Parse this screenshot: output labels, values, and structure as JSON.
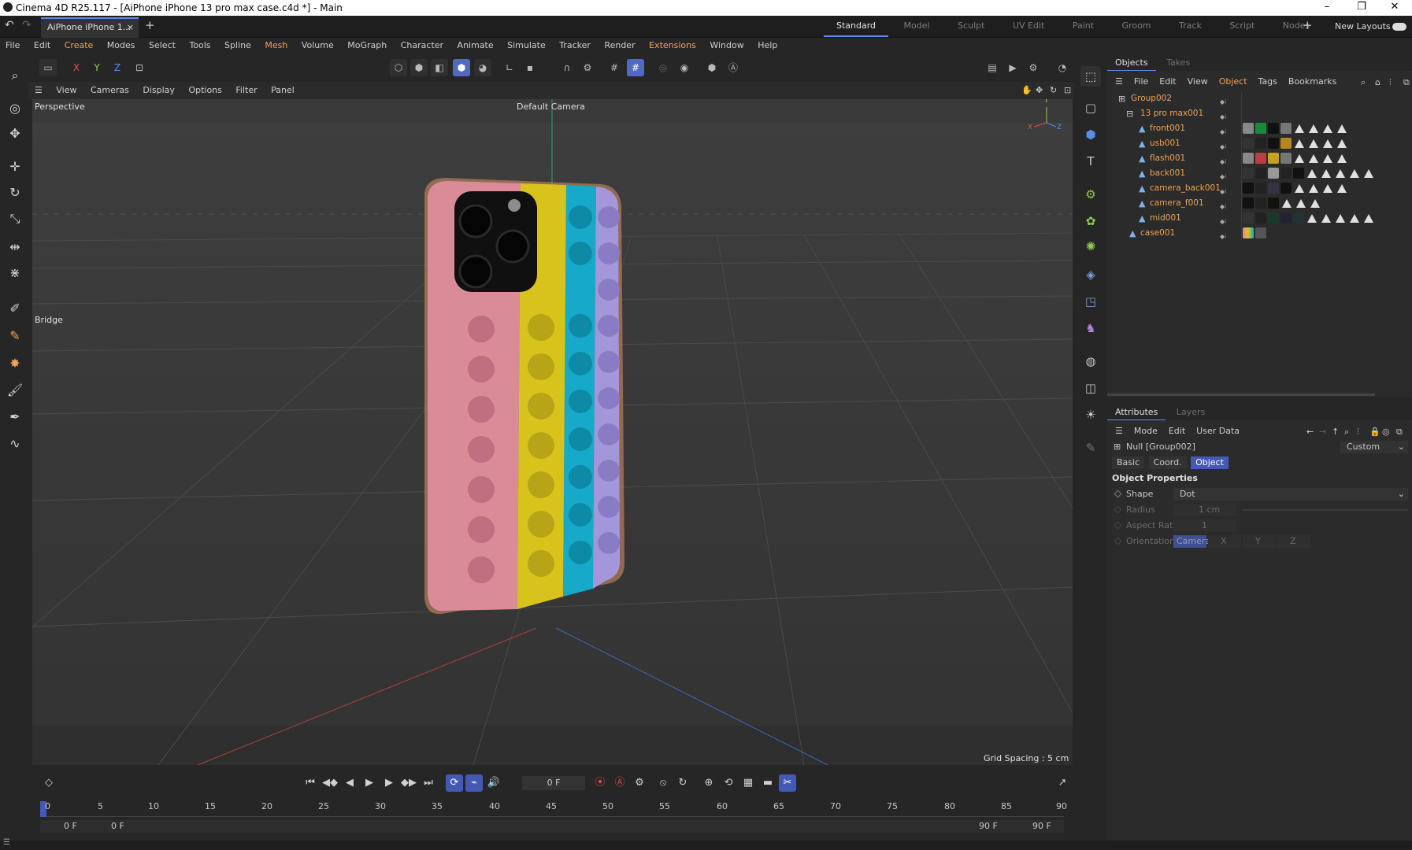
{
  "window": {
    "title": "Cinema 4D R25.117 - [AiPhone iPhone 13 pro max case.c4d *] - Main",
    "min_label": "–",
    "max_label": "❐",
    "close_label": "✕"
  },
  "tabbar": {
    "doc_tab": "AiPhone iPhone 1...",
    "doc_tab_close": "×",
    "add_tab": "+",
    "layouts": [
      {
        "label": "Standard"
      },
      {
        "label": "Model"
      },
      {
        "label": "Sculpt"
      },
      {
        "label": "UV Edit"
      },
      {
        "label": "Paint"
      },
      {
        "label": "Groom"
      },
      {
        "label": "Track"
      },
      {
        "label": "Script"
      },
      {
        "label": "Nodes"
      }
    ],
    "plus": "+",
    "new_layouts": "New Layouts"
  },
  "menubar": {
    "items": [
      "File",
      "Edit",
      "Create",
      "Modes",
      "Select",
      "Tools",
      "Spline",
      "Mesh",
      "Volume",
      "MoGraph",
      "Character",
      "Animate",
      "Simulate",
      "Tracker",
      "Render",
      "Extensions",
      "Window",
      "Help"
    ]
  },
  "toolbar": {
    "axis_x": "X",
    "axis_y": "Y",
    "axis_z": "Z"
  },
  "viewport": {
    "menu": [
      "View",
      "Cameras",
      "Display",
      "Options",
      "Filter",
      "Panel"
    ],
    "projection": "Perspective",
    "camera": "Default Camera",
    "bridge_label": "Bridge",
    "grid_spacing": "Grid Spacing : 5 cm",
    "gizmo_x": "X",
    "gizmo_y": "Y",
    "gizmo_z": "Z"
  },
  "timeline": {
    "current_frame": "0 F",
    "ruler_ticks": [
      "0",
      "5",
      "10",
      "15",
      "20",
      "25",
      "30",
      "35",
      "40",
      "45",
      "50",
      "55",
      "60",
      "65",
      "70",
      "75",
      "80",
      "85",
      "90"
    ],
    "range_start": "0 F",
    "range_start_inner": "0 F",
    "range_end_inner": "90 F",
    "range_end": "90 F"
  },
  "objects_panel": {
    "tabs": [
      {
        "label": "Objects"
      },
      {
        "label": "Takes"
      }
    ],
    "menu": [
      "File",
      "Edit",
      "View",
      "Object",
      "Tags",
      "Bookmarks"
    ],
    "rows": [
      {
        "name": "Group002",
        "indent": 0
      },
      {
        "name": "13 pro max001",
        "indent": 1
      },
      {
        "name": "front001",
        "indent": 2
      },
      {
        "name": "usb001",
        "indent": 2
      },
      {
        "name": "flash001",
        "indent": 2
      },
      {
        "name": "back001",
        "indent": 2
      },
      {
        "name": "camera_back001",
        "indent": 2
      },
      {
        "name": "camera_f001",
        "indent": 2
      },
      {
        "name": "mid001",
        "indent": 2
      },
      {
        "name": "case001",
        "indent": 1
      }
    ]
  },
  "attributes_panel": {
    "tabs": [
      {
        "label": "Attributes"
      },
      {
        "label": "Layers"
      }
    ],
    "menu": [
      "Mode",
      "Edit",
      "User Data"
    ],
    "object_name": "Null [Group002]",
    "preset": "Custom",
    "subtabs": [
      {
        "label": "Basic"
      },
      {
        "label": "Coord."
      },
      {
        "label": "Object"
      }
    ],
    "section_title": "Object Properties",
    "shape_label": "Shape",
    "shape_value": "Dot",
    "radius_label": "Radius",
    "radius_value": "1 cm",
    "aspect_label": "Aspect Ratio",
    "aspect_value": "1",
    "orientation_label": "Orientation",
    "orientation_value": "Camera",
    "orient_x": "X",
    "orient_y": "Y",
    "orient_z": "Z"
  },
  "colors": {
    "accent": "#5b8ee6",
    "selected_button": "#4459b6",
    "object_name": "#f0a356",
    "case_pink": "#d98c97",
    "case_yellow": "#d8c31c",
    "case_cyan": "#17a9c9",
    "case_purple": "#a497d9"
  }
}
